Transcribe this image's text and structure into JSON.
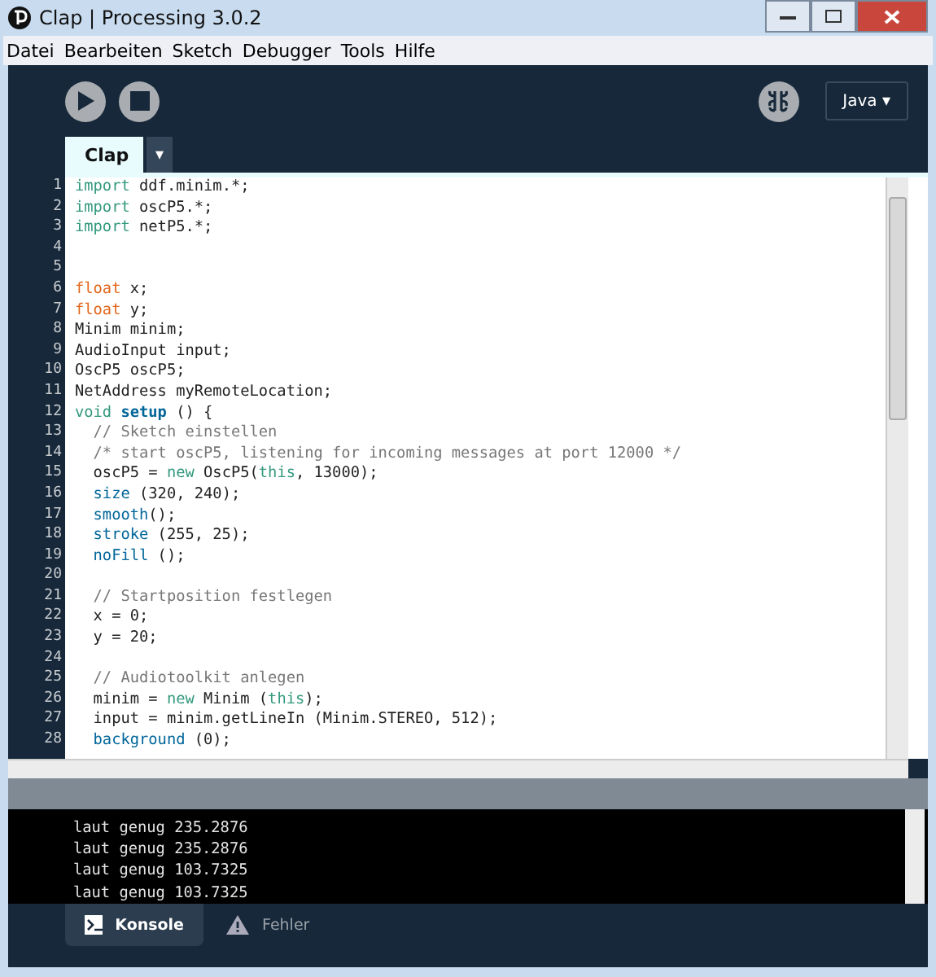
{
  "window": {
    "title": "Clap | Processing 3.0.2"
  },
  "menu": [
    "Datei",
    "Bearbeiten",
    "Sketch",
    "Debugger",
    "Tools",
    "Hilfe"
  ],
  "toolbar": {
    "mode": "Java ▾"
  },
  "tabs": [
    {
      "label": "Clap",
      "selected": true
    }
  ],
  "tab_menu": "▾",
  "editor": {
    "lines": [
      {
        "n": "1",
        "parts": [
          {
            "t": "import ",
            "kind": "keyword"
          },
          {
            "t": "ddf.minim.*;",
            "kind": "plain"
          }
        ]
      },
      {
        "n": "2",
        "parts": [
          {
            "t": "import ",
            "kind": "keyword"
          },
          {
            "t": "oscP5.*;",
            "kind": "plain"
          }
        ]
      },
      {
        "n": "3",
        "parts": [
          {
            "t": "import ",
            "kind": "keyword"
          },
          {
            "t": "netP5.*;",
            "kind": "plain"
          }
        ]
      },
      {
        "n": "4"
      },
      {
        "n": "5"
      },
      {
        "n": "6",
        "parts": [
          {
            "t": "float ",
            "kind": "type"
          },
          {
            "t": "x;",
            "kind": "plain"
          }
        ]
      },
      {
        "n": "7",
        "parts": [
          {
            "t": "float ",
            "kind": "type"
          },
          {
            "t": "y;",
            "kind": "plain"
          }
        ]
      },
      {
        "n": "8",
        "parts": [
          {
            "t": "Minim minim;",
            "kind": "plain"
          }
        ]
      },
      {
        "n": "9",
        "parts": [
          {
            "t": "AudioInput input;",
            "kind": "plain"
          }
        ]
      },
      {
        "n": "10",
        "parts": [
          {
            "t": "OscP5 oscP5;",
            "kind": "plain"
          }
        ]
      },
      {
        "n": "11",
        "parts": [
          {
            "t": "NetAddress myRemoteLocation;",
            "kind": "plain"
          }
        ]
      },
      {
        "n": "12",
        "parts": [
          {
            "t": "void ",
            "kind": "keyword"
          },
          {
            "t": "setup",
            "kind": "function"
          },
          {
            "t": " () {",
            "kind": "plain"
          }
        ]
      },
      {
        "n": "13",
        "parts": [
          {
            "t": "  // Sketch einstellen",
            "kind": "comment"
          }
        ]
      },
      {
        "n": "14",
        "parts": [
          {
            "t": "  /* start oscP5, listening for incoming messages at port 12000 */",
            "kind": "comment"
          }
        ]
      },
      {
        "n": "15",
        "parts": [
          {
            "t": "  oscP5 = ",
            "kind": "plain"
          },
          {
            "t": "new",
            "kind": "keyword"
          },
          {
            "t": " OscP5(",
            "kind": "plain"
          },
          {
            "t": "this",
            "kind": "keyword"
          },
          {
            "t": ", 13000);",
            "kind": "plain"
          }
        ]
      },
      {
        "n": "16",
        "parts": [
          {
            "t": "  size",
            "kind": "builtin"
          },
          {
            "t": " (320, 240);",
            "kind": "plain"
          }
        ]
      },
      {
        "n": "17",
        "parts": [
          {
            "t": "  smooth",
            "kind": "builtin"
          },
          {
            "t": "();",
            "kind": "plain"
          }
        ]
      },
      {
        "n": "18",
        "parts": [
          {
            "t": "  stroke",
            "kind": "builtin"
          },
          {
            "t": " (255, 25);",
            "kind": "plain"
          }
        ]
      },
      {
        "n": "19",
        "parts": [
          {
            "t": "  noFill",
            "kind": "builtin"
          },
          {
            "t": " ();",
            "kind": "plain"
          }
        ]
      },
      {
        "n": "20"
      },
      {
        "n": "21",
        "parts": [
          {
            "t": "  // Startposition festlegen",
            "kind": "comment"
          }
        ]
      },
      {
        "n": "22",
        "parts": [
          {
            "t": "  x = 0;",
            "kind": "plain"
          }
        ]
      },
      {
        "n": "23",
        "parts": [
          {
            "t": "  y = 20;",
            "kind": "plain"
          }
        ]
      },
      {
        "n": "24"
      },
      {
        "n": "25",
        "parts": [
          {
            "t": "  // Audiotoolkit anlegen",
            "kind": "comment"
          }
        ]
      },
      {
        "n": "26",
        "parts": [
          {
            "t": "  minim = ",
            "kind": "plain"
          },
          {
            "t": "new",
            "kind": "keyword"
          },
          {
            "t": " Minim (",
            "kind": "plain"
          },
          {
            "t": "this",
            "kind": "keyword"
          },
          {
            "t": ");",
            "kind": "plain"
          }
        ]
      },
      {
        "n": "27",
        "parts": [
          {
            "t": "  input = minim.getLineIn (Minim.STEREO, 512);",
            "kind": "plain"
          }
        ]
      },
      {
        "n": "28",
        "parts": [
          {
            "t": "  background",
            "kind": "builtin"
          },
          {
            "t": " (0);",
            "kind": "plain"
          }
        ]
      }
    ]
  },
  "console": {
    "lines": [
      "laut genug 235.2876",
      "laut genug 235.2876",
      "laut genug 103.7325",
      "laut genug 103.7325"
    ]
  },
  "bottom_tabs": [
    {
      "label": "Konsole",
      "kind": "console",
      "selected": true
    },
    {
      "label": "Fehler",
      "kind": "errors",
      "selected": false
    }
  ]
}
